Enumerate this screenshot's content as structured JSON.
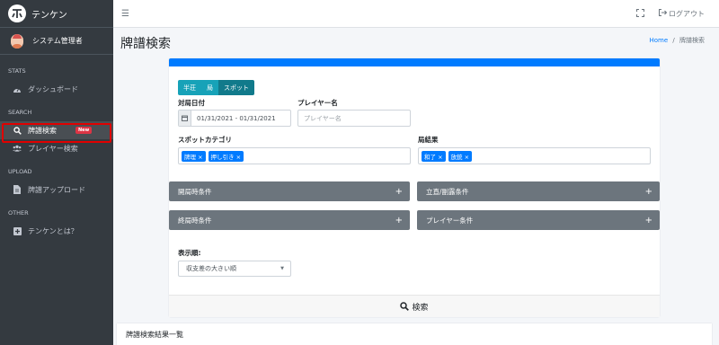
{
  "brand": {
    "name": "テンケン"
  },
  "user": {
    "name": "システム管理者"
  },
  "sidebar": {
    "sections": [
      {
        "header": "STATS",
        "items": [
          {
            "icon": "tachometer-icon",
            "label": "ダッシュボード"
          }
        ]
      },
      {
        "header": "SEARCH",
        "items": [
          {
            "icon": "search-icon",
            "label": "牌譜検索",
            "badge": "New",
            "active": true
          },
          {
            "icon": "users-icon",
            "label": "プレイヤー検索"
          }
        ]
      },
      {
        "header": "UPLOAD",
        "items": [
          {
            "icon": "file-icon",
            "label": "牌譜アップロード"
          }
        ]
      },
      {
        "header": "OTHER",
        "items": [
          {
            "icon": "plus-square-icon",
            "label": "テンケンとは？"
          }
        ]
      }
    ]
  },
  "topbar": {
    "logout_label": "ログアウト"
  },
  "page": {
    "title": "牌譜検索"
  },
  "breadcrumb": {
    "home": "Home",
    "separator": "/",
    "current": "牌譜検索"
  },
  "form": {
    "modes": [
      "半荘",
      "局",
      "スポット"
    ],
    "selected_mode": "スポット",
    "date_label": "対局日付",
    "date_value": "01/31/2021 - 01/31/2021",
    "player_label": "プレイヤー名",
    "player_placeholder": "プレイヤー名",
    "spot_label": "スポットカテゴリ",
    "spot_tags": [
      "牌理 ×",
      "押し引き ×"
    ],
    "result_label": "局結果",
    "result_tags": [
      "和了 ×",
      "放銃 ×"
    ],
    "collapsibles": [
      "開局時条件",
      "立直/副露条件",
      "終局時条件",
      "プレイヤー条件"
    ],
    "sort_label": "表示順:",
    "sort_value": "収支差の大きい順",
    "search_button": "検索"
  },
  "results": {
    "title": "牌譜検索結果一覧"
  },
  "colors": {
    "accent": "#007bff",
    "sidebar": "#343a40",
    "mode_button": "#17a2b8",
    "collapse": "#6c757d",
    "badge": "#dc3545",
    "highlight": "#e00000"
  }
}
